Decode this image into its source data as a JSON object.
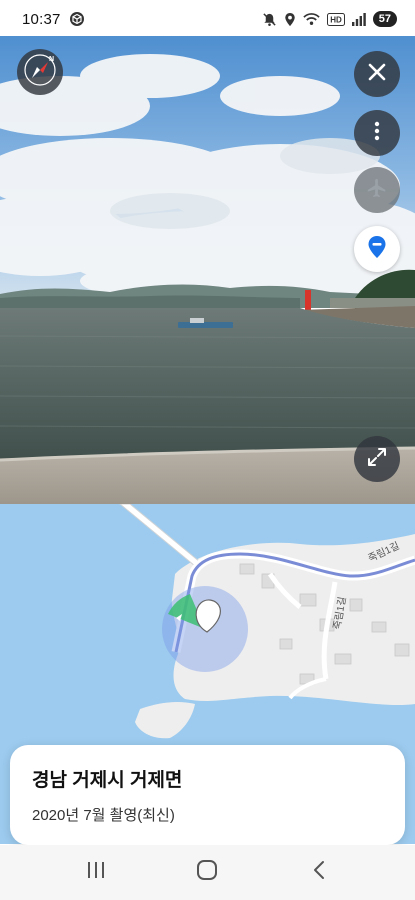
{
  "status_bar": {
    "time": "10:37",
    "battery": "57",
    "icons": [
      "cube-icon",
      "mute-icon",
      "location-icon",
      "wifi-icon",
      "hd-icon",
      "signal-icon",
      "battery-icon"
    ]
  },
  "street_view": {
    "buttons": [
      {
        "name": "compass-button",
        "icon": "compass-icon"
      },
      {
        "name": "close-button",
        "icon": "close-icon"
      },
      {
        "name": "more-options-button",
        "icon": "more-vertical-icon"
      },
      {
        "name": "aerial-view-button",
        "icon": "airplane-icon"
      },
      {
        "name": "location-marker-button",
        "icon": "location-pin-icon"
      },
      {
        "name": "expand-button",
        "icon": "expand-icon"
      }
    ]
  },
  "map": {
    "road_labels": [
      "죽림1길",
      "죽림1길"
    ]
  },
  "info_card": {
    "title": "경남 거제시 거제면",
    "subtitle": "2020년 7월 촬영(최신)"
  },
  "colors": {
    "accent": "#1a73e8",
    "water": "#9ccbef",
    "land": "#eeeeee",
    "route": "#7b8cd6"
  }
}
